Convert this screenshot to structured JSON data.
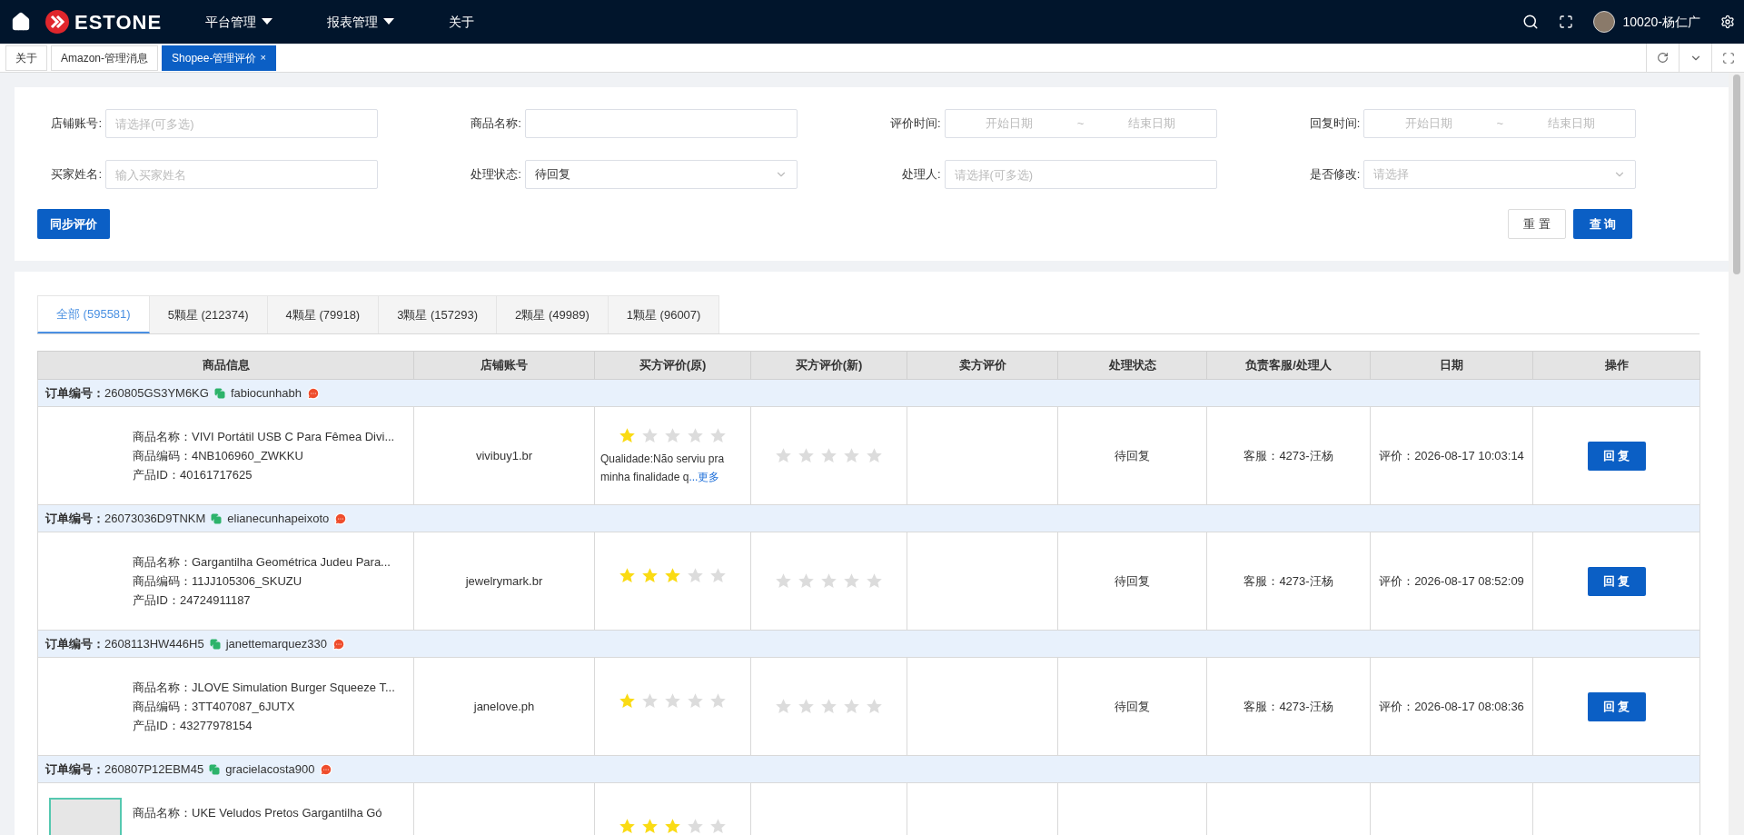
{
  "top_nav": {
    "brand": "ESTONE",
    "menus": [
      {
        "label": "平台管理",
        "has_caret": true
      },
      {
        "label": "报表管理",
        "has_caret": true
      },
      {
        "label": "关于",
        "has_caret": false
      }
    ],
    "user": "10020-杨仁广"
  },
  "page_tabs": [
    {
      "label": "关于",
      "selected": false,
      "closable": false
    },
    {
      "label": "Amazon-管理消息",
      "selected": false,
      "closable": false
    },
    {
      "label": "Shopee-管理评价",
      "selected": true,
      "closable": true,
      "close": "×"
    }
  ],
  "filters": [
    {
      "kind": "text",
      "label": "店铺账号:",
      "placeholder": "请选择(可多选)"
    },
    {
      "kind": "text",
      "label": "商品名称:"
    },
    {
      "kind": "date_range",
      "label": "评价时间:",
      "start_placeholder": "开始日期",
      "separator": "~",
      "end_placeholder": "结束日期"
    },
    {
      "kind": "date_range",
      "label": "回复时间:",
      "start_placeholder": "开始日期",
      "separator": "~",
      "end_placeholder": "结束日期"
    },
    {
      "kind": "text",
      "label": "买家姓名:",
      "placeholder": "输入买家姓名"
    },
    {
      "kind": "select",
      "label": "处理状态:",
      "value": "待回复"
    },
    {
      "kind": "text",
      "label": "处理人:",
      "placeholder": "请选择(可多选)"
    },
    {
      "kind": "select",
      "label": "是否修改:",
      "placeholder": "请选择"
    }
  ],
  "buttons": {
    "sync": "同步评价",
    "reset": "重 置",
    "search": "查 询"
  },
  "rating_tabs": [
    {
      "label": "全部 (595581)",
      "selected": true
    },
    {
      "label": "5颗星 (212374)",
      "selected": false
    },
    {
      "label": "4颗星 (79918)",
      "selected": false
    },
    {
      "label": "3颗星 (157293)",
      "selected": false
    },
    {
      "label": "2颗星 (49989)",
      "selected": false
    },
    {
      "label": "1颗星 (96007)",
      "selected": false
    }
  ],
  "table": {
    "columns": [
      "商品信息",
      "店铺账号",
      "买方评价(原)",
      "买方评价(新)",
      "卖方评价",
      "处理状态",
      "负责客服/处理人",
      "日期",
      "操作"
    ],
    "rows": [
      {
        "order_label": "订单编号：",
        "order_no": "260805GS3YM6KG",
        "buyer": "fabiocunhabh",
        "product_name": "商品名称：VIVI Portátil USB C Para Fêmea Divi...",
        "sku": "商品编码：4NB106960_ZWKKU",
        "product_id": "产品ID：40161717625",
        "shop": "vivibuy1.br",
        "original_review": {
          "stars": 1,
          "text": "Qualidade:Não serviu pra minha finalidade q",
          "more": "...更多"
        },
        "new_review": {
          "stars": 0
        },
        "status": "待回复",
        "agent": "客服：4273-汪杨",
        "date": "评价：2026-08-17 10:03:14",
        "action": "回 复"
      },
      {
        "order_label": "订单编号：",
        "order_no": "26073036D9TNKM",
        "buyer": "elianecunhapeixoto",
        "product_name": "商品名称：Gargantilha Geométrica Judeu Para...",
        "sku": "商品编码：11JJ105306_SKUZU",
        "product_id": "产品ID：24724911187",
        "shop": "jewelrymark.br",
        "original_review": {
          "stars": 3
        },
        "new_review": {
          "stars": 0
        },
        "status": "待回复",
        "agent": "客服：4273-汪杨",
        "date": "评价：2026-08-17 08:52:09",
        "action": "回 复"
      },
      {
        "order_label": "订单编号：",
        "order_no": "2608113HW446H5",
        "buyer": "janettemarquez330",
        "product_name": "商品名称：JLOVE Simulation Burger Squeeze T...",
        "sku": "商品编码：3TT407087_6JUTX",
        "product_id": "产品ID：43277978154",
        "shop": "janelove.ph",
        "original_review": {
          "stars": 1
        },
        "new_review": {
          "stars": 0
        },
        "status": "待回复",
        "agent": "客服：4273-汪杨",
        "date": "评价：2026-08-17 08:08:36",
        "action": "回 复"
      },
      {
        "order_label": "订单编号：",
        "order_no": "260807P12EBM45",
        "buyer": "gracielacosta900",
        "has_image": true,
        "product_name": "商品名称：UKE Veludos Pretos Gargantilha Gó",
        "original_review": {
          "stars": 3
        }
      }
    ]
  }
}
